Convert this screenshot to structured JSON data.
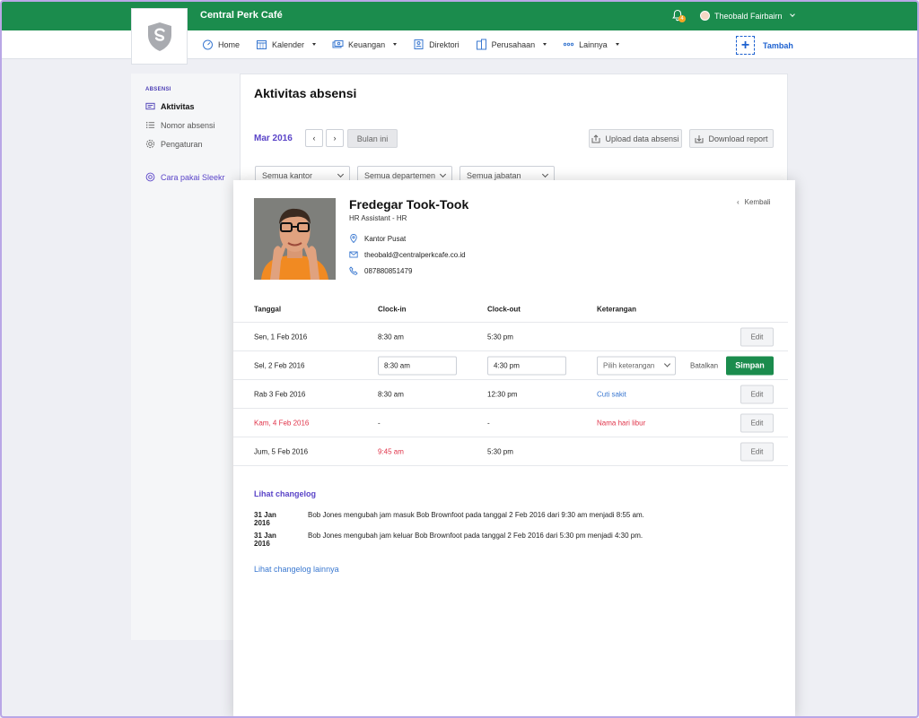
{
  "header": {
    "app_title": "Central Perk Café",
    "notification_count": "4",
    "user_name": "Theobald Fairbairn"
  },
  "nav": {
    "items": [
      {
        "label": "Home",
        "icon": "speedometer-icon",
        "dropdown": false
      },
      {
        "label": "Kalender",
        "icon": "calendar-icon",
        "dropdown": true
      },
      {
        "label": "Keuangan",
        "icon": "money-icon",
        "dropdown": true
      },
      {
        "label": "Direktori",
        "icon": "contact-card-icon",
        "dropdown": false
      },
      {
        "label": "Perusahaan",
        "icon": "building-icon",
        "dropdown": true
      },
      {
        "label": "Lainnya",
        "icon": "more-dots-icon",
        "dropdown": true
      }
    ],
    "add_label": "Tambah"
  },
  "sidebar": {
    "section": "ABSENSI",
    "items": [
      {
        "label": "Aktivitas",
        "active": true
      },
      {
        "label": "Nomor absensi",
        "active": false
      },
      {
        "label": "Pengaturan",
        "active": false
      }
    ],
    "help_link": "Cara pakai Sleekr"
  },
  "page": {
    "title": "Aktivitas absensi",
    "month": "Mar 2016",
    "this_month_button": "Bulan ini",
    "upload_button": "Upload data absensi",
    "download_button": "Download report",
    "filters": [
      "Semua kantor",
      "Semua departemen",
      "Semua jabatan"
    ]
  },
  "employee": {
    "name": "Fredegar Took-Took",
    "role": "HR Assistant - HR",
    "office": "Kantor Pusat",
    "email": "theobald@centralperkcafe.co.id",
    "phone": "087880851479",
    "back_label": "Kembali"
  },
  "table": {
    "headers": [
      "Tanggal",
      "Clock-in",
      "Clock-out",
      "Keterangan"
    ],
    "rows": [
      {
        "date": "Sen, 1 Feb 2016",
        "clock_in": "8:30 am",
        "clock_out": "5:30 pm",
        "note": "",
        "action": "Edit"
      },
      {
        "date": "Sel, 2 Feb 2016",
        "clock_in": "8:30 am",
        "clock_out": "4:30 pm",
        "note_placeholder": "Pilih keterangan",
        "cancel": "Batalkan",
        "save": "Simpan"
      },
      {
        "date": "Rab 3 Feb 2016",
        "clock_in": "8:30 am",
        "clock_out": "12:30 pm",
        "note": "Cuti sakit",
        "action": "Edit"
      },
      {
        "date": "Kam, 4 Feb 2016",
        "clock_in": "-",
        "clock_out": "-",
        "note": "Nama hari libur",
        "action": "Edit"
      },
      {
        "date": "Jum, 5 Feb 2016",
        "clock_in": "9:45 am",
        "clock_out": "5:30 pm",
        "note": "",
        "action": "Edit"
      }
    ]
  },
  "changelog": {
    "title": "Lihat changelog",
    "entries": [
      {
        "date": "31 Jan 2016",
        "text": "Bob Jones mengubah jam masuk Bob Brownfoot pada tanggal 2 Feb 2016 dari 9:30 am menjadi 8:55 am."
      },
      {
        "date": "31 Jan 2016",
        "text": "Bob Jones mengubah jam keluar Bob Brownfoot pada tanggal 2 Feb 2016  dari 5:30 pm menjadi 4:30 pm."
      }
    ],
    "more": "Lihat changelog lainnya"
  },
  "colors": {
    "brand_green": "#1b8c4d",
    "accent_purple": "#5a44c8",
    "link_blue": "#3a78d0",
    "alert_red": "#e0344a"
  }
}
